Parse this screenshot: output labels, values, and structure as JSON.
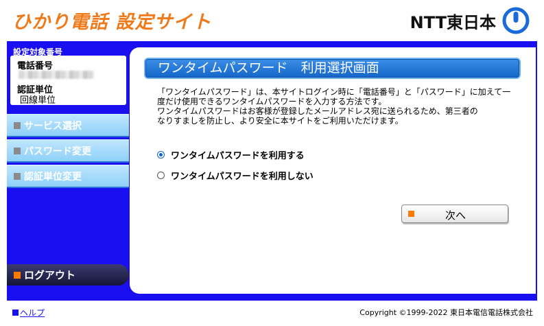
{
  "header": {
    "site_title": "ひかり電話 設定サイト",
    "logo_text": "NTT東日本"
  },
  "sidebar": {
    "target_label": "設定対象番号",
    "phone_label": "電話番号",
    "phone_value": "",
    "unit_label": "認証単位",
    "unit_value": "回線単位",
    "items": [
      {
        "label": "サービス選択"
      },
      {
        "label": "パスワード変更"
      },
      {
        "label": "認証単位変更"
      }
    ],
    "logout_label": "ログアウト"
  },
  "main": {
    "page_title": "ワンタイムパスワード　利用選択画面",
    "description": [
      "「ワンタイムパスワード」は、本サイトログイン時に「電話番号」と「パスワード」に加えて一",
      "度だけ使用できるワンタイムパスワードを入力する方法です。",
      "ワンタイムパスワードはお客様が登録したメールアドレス宛に送られるため、第三者の",
      "なりすましを防止し、より安全に本サイトをご利用いただけます。"
    ],
    "options": [
      {
        "label": "ワンタイムパスワードを利用する",
        "selected": true
      },
      {
        "label": "ワンタイムパスワードを利用しない",
        "selected": false
      }
    ],
    "next_label": "次へ"
  },
  "footer": {
    "help_label": "ヘルプ",
    "copyright": "Copyright ©1999-2022 東日本電信電話株式会社"
  },
  "colors": {
    "brand_orange": "#f07a1a",
    "frame_blue": "#1a0ff0",
    "nav_light_blue": "#a8dcff",
    "heading_blue": "#1e78d8"
  },
  "icons": [
    "ntt-logo-icon",
    "square-bullet-icon",
    "radio-icon"
  ]
}
